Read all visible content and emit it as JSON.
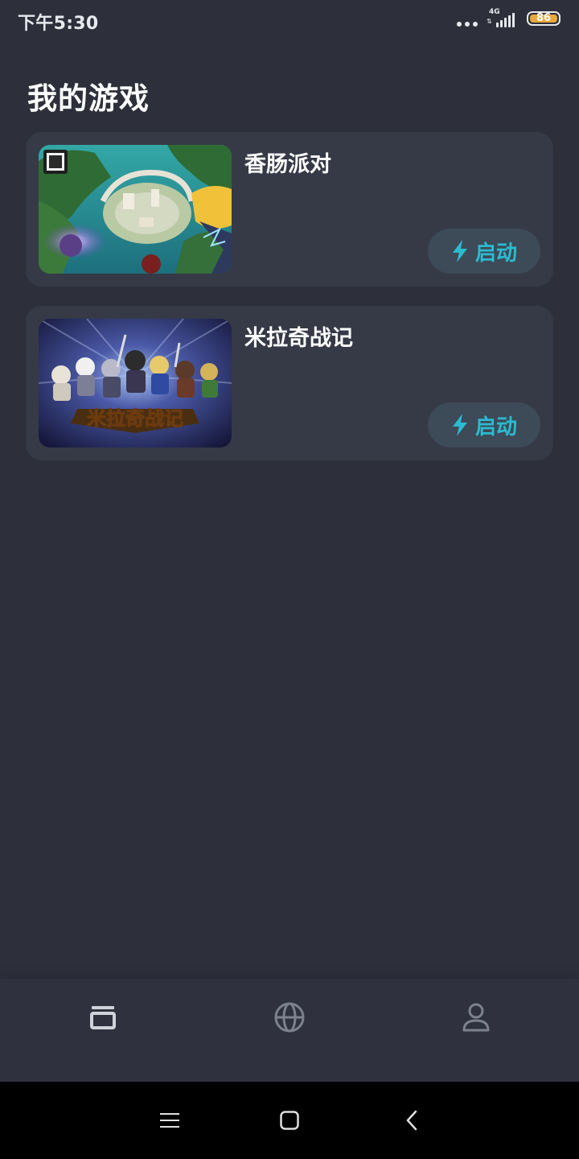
{
  "status_bar": {
    "time": "下午5:30",
    "network": "4G",
    "battery_level": "86",
    "colors": {
      "battery_fill": "#e8a83a"
    }
  },
  "page": {
    "title": "我的游戏"
  },
  "games": [
    {
      "title": "香肠派对",
      "launch_label": "启动",
      "thumbnail_icon": "sausage-party-cover-image"
    },
    {
      "title": "米拉奇战记",
      "launch_label": "启动",
      "thumbnail_icon": "miracle-war-cover-image",
      "thumbnail_text": "米拉奇战记"
    }
  ],
  "bottom_nav": {
    "items": [
      {
        "icon": "games-icon",
        "active": true
      },
      {
        "icon": "globe-icon",
        "active": false
      },
      {
        "icon": "person-icon",
        "active": false
      }
    ]
  },
  "system_nav": {
    "items": [
      "menu-icon",
      "home-icon",
      "back-icon"
    ]
  },
  "colors": {
    "background": "#2d303b",
    "card": "#363a47",
    "accent": "#2bbbd0",
    "launch_button_bg": "#3d4a57",
    "nav_active": "#cfd2da",
    "nav_inactive": "#7d818d"
  }
}
